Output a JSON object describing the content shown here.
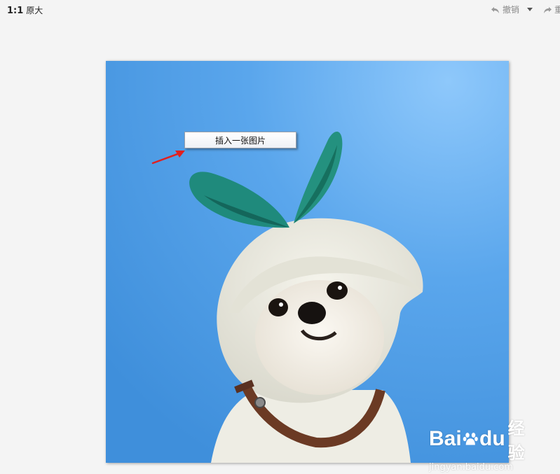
{
  "toolbar": {
    "zoom_ratio": "1:1",
    "zoom_label": "原大",
    "undo_label": "撤销",
    "redo_label": "重做"
  },
  "context_menu": {
    "item_label": "插入一张图片"
  },
  "watermark": {
    "brand_part1": "Bai",
    "brand_part2": "du",
    "brand_cn": "经验",
    "url": "jingyan.baidu.com"
  },
  "colors": {
    "sky": "#4a97e0",
    "arrow": "#e02020",
    "hat_green": "#1f8a7c"
  }
}
